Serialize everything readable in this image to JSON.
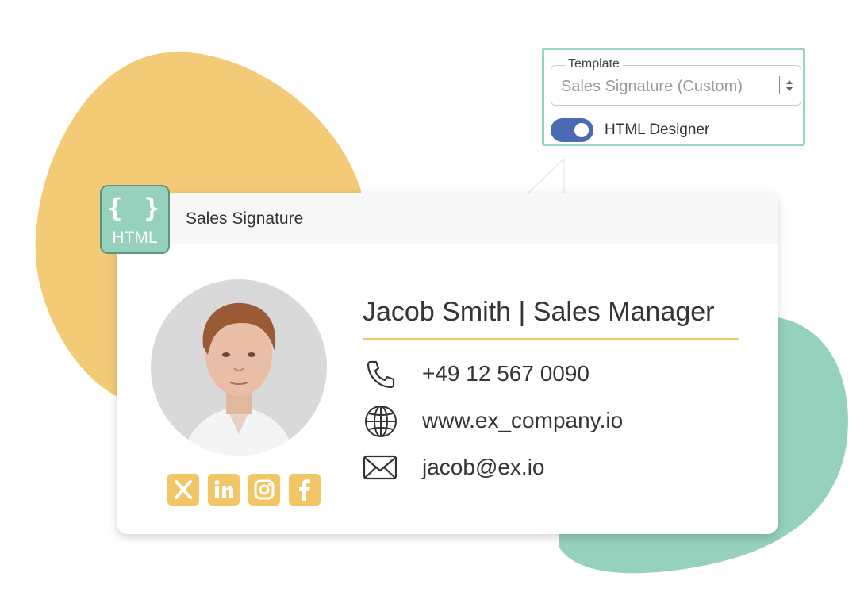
{
  "template": {
    "label": "Template",
    "selected": "Sales Signature (Custom)",
    "html_designer_label": "HTML Designer",
    "html_designer_enabled": true
  },
  "card": {
    "title": "Sales Signature",
    "badge_braces": "{ }",
    "badge_label": "HTML"
  },
  "signature": {
    "name_title": "Jacob Smith | Sales Manager",
    "phone": "+49 12 567 0090",
    "website": "www.ex_company.io",
    "email": "jacob@ex.io"
  },
  "social": [
    "x-icon",
    "linkedin-icon",
    "instagram-icon",
    "facebook-icon"
  ],
  "colors": {
    "accent_yellow": "#f2c566",
    "blob_yellow": "#f3cb76",
    "blob_green": "#96d1bd",
    "toggle_blue": "#4a6ab4",
    "popup_border": "#9ad3c0"
  }
}
